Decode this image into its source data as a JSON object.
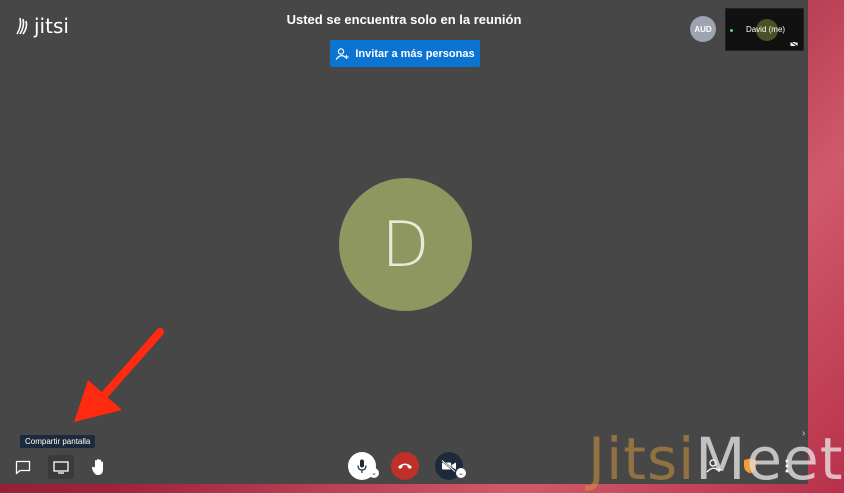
{
  "header": {
    "logo_text": "jitsi",
    "meeting_title": "Usted se encuentra solo en la reunión",
    "invite_button_label": "Invitar a más personas"
  },
  "participants": {
    "audio_badge": "AUD",
    "self_name": "David (me)",
    "main_avatar_initial": "D",
    "main_avatar_color": "#8e9760"
  },
  "toolbar": {
    "tooltip": "Compartir pantalla",
    "left": [
      "chat-icon",
      "screen-share-icon",
      "raise-hand-icon"
    ],
    "center": [
      "microphone-icon",
      "hangup-icon",
      "camera-off-icon"
    ],
    "right": [
      "invite-icon",
      "security-shield-icon",
      "more-options-icon"
    ],
    "hangup_color": "#c0302a",
    "invite_color": "#0b73d1"
  },
  "overlay": {
    "watermark_part1": "Jitsi",
    "watermark_part2": "Meet",
    "arrow_color": "#ff2a10"
  }
}
